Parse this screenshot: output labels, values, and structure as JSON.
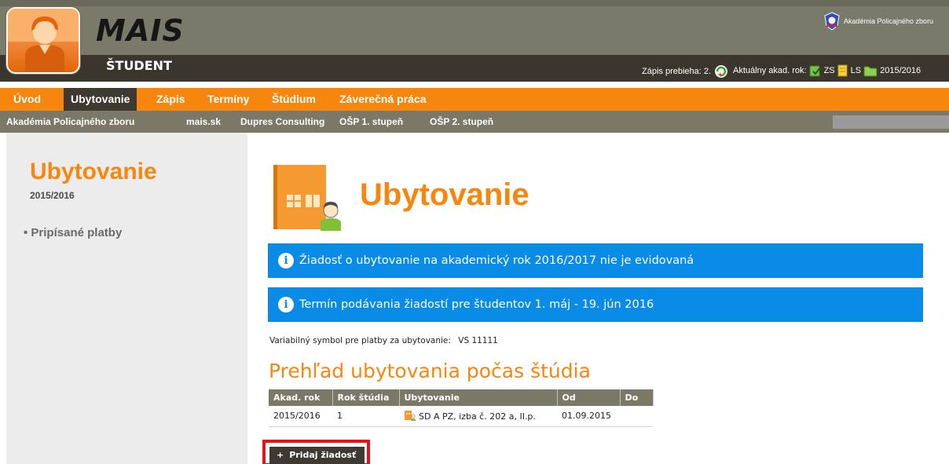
{
  "app": {
    "brand": "MAIS",
    "role": "ŠTUDENT"
  },
  "header": {
    "institution": "Akadémia Policajného zboru",
    "enrollment": "Zápis prebieha: 2.",
    "acad_year_label": "Aktuálny akad. rok:",
    "winter": "ZS",
    "summer": "LS",
    "year": "2015/2016"
  },
  "nav_main": [
    "Úvod",
    "Ubytovanie",
    "Zápis",
    "Termíny",
    "Štúdium",
    "Záverečná práca"
  ],
  "nav_sub": [
    "Akadémia Policajného zboru",
    "mais.sk",
    "Dupres Consulting",
    "OŠP 1. stupeň",
    "OŠP 2. stupeň"
  ],
  "sidebar": {
    "title": "Ubytovanie",
    "year": "2015/2016",
    "link": "• Pripísané platby"
  },
  "main": {
    "title": "Ubytovanie",
    "alerts": [
      "Žiadosť o ubytovanie na akademický rok 2016/2017 nie je evidovaná",
      "Termín podávania žiadostí pre študentov 1. máj - 19. jún 2016"
    ],
    "vs_label": "Variabilný symbol pre platby za ubytovanie:",
    "vs_value": "VS 11111",
    "overview_title": "Prehľad ubytovania počas štúdia",
    "table": {
      "headers": [
        "Akad. rok",
        "Rok štúdia",
        "Ubytovanie",
        "Od",
        "Do"
      ],
      "rows": [
        [
          "2015/2016",
          "1",
          "SD A PZ, izba č. 202 a, II.p.",
          "01.09.2015",
          ""
        ]
      ]
    },
    "add_button": "Pridaj žiadosť"
  },
  "colors": {
    "accent": "#f7860f",
    "info": "#0a8ce6",
    "dark": "#3f3a31",
    "highlight": "#e5121b"
  }
}
